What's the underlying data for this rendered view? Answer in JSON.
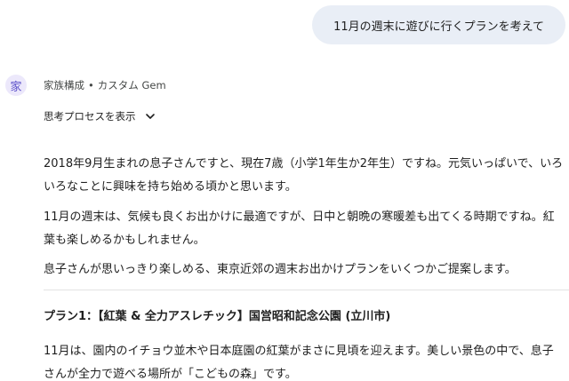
{
  "user_message": "11月の週末に遊びに行くプランを考えて",
  "assistant": {
    "avatar_char": "家",
    "name": "家族構成",
    "separator": "•",
    "type": "カスタム Gem",
    "thinking_toggle": "思考プロセスを表示",
    "paragraphs": [
      "2018年9月生まれの息子さんですと、現在7歳（小学1年生か2年生）ですね。元気いっぱいで、いろいろなことに興味を持ち始める頃かと思います。",
      "11月の週末は、気候も良くお出かけに最適ですが、日中と朝晩の寒暖差も出てくる時期ですね。紅葉も楽しめるかもしれません。",
      "息子さんが思いっきり楽しめる、東京近郊の週末お出かけプランをいくつかご提案します。"
    ],
    "plan_title": "プラン1：【紅葉 & 全力アスレチック】国営昭和記念公園 (立川市)",
    "plan_text": "11月は、園内のイチョウ並木や日本庭園の紅葉がまさに見頃を迎えます。美しい景色の中で、息子さんが全力で遊べる場所が「こどもの森」です。"
  },
  "colors": {
    "user_bubble": "#e9eef6",
    "avatar_bg": "#ece8fb",
    "avatar_fg": "#5b50c9",
    "divider": "#e3e3e3"
  }
}
